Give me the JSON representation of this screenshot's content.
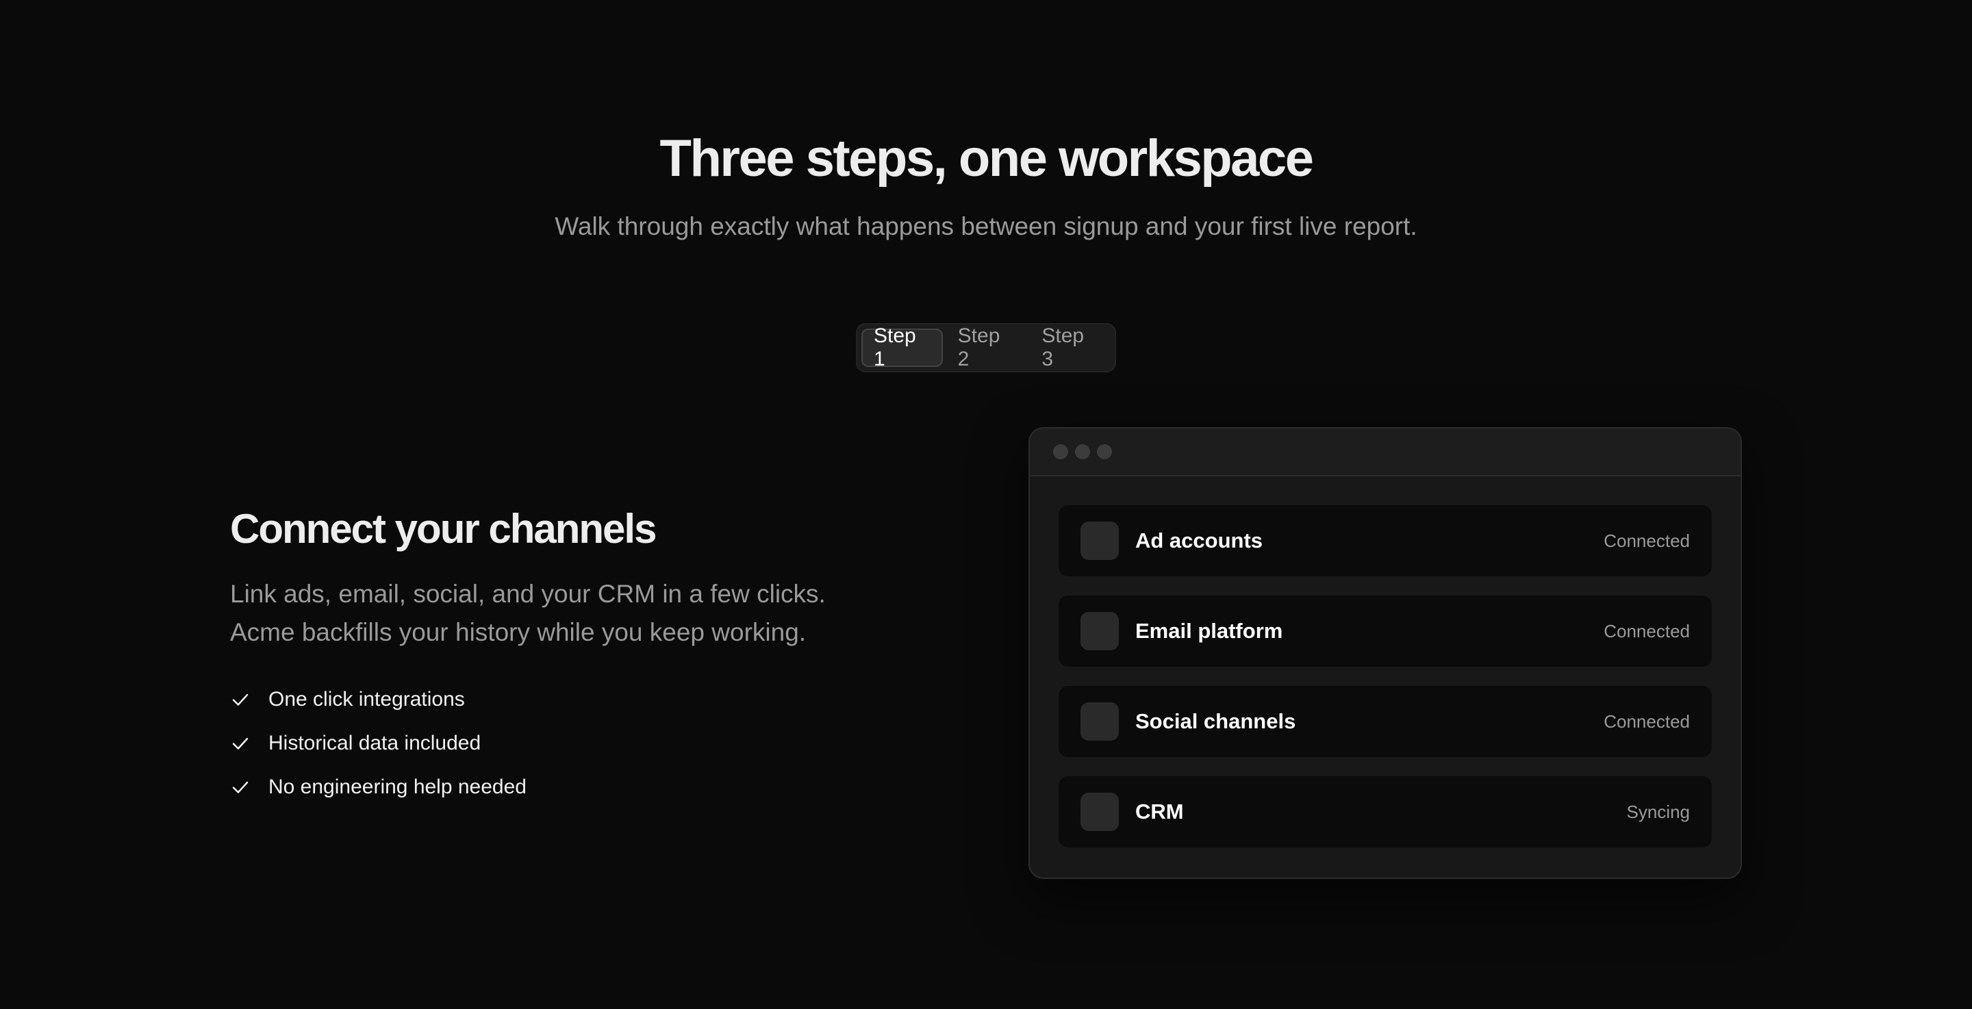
{
  "header": {
    "title": "Three steps, one workspace",
    "subtitle": "Walk through exactly what happens between signup and your first live report."
  },
  "tabs": [
    {
      "label": "Step 1",
      "active": true
    },
    {
      "label": "Step 2",
      "active": false
    },
    {
      "label": "Step 3",
      "active": false
    }
  ],
  "step": {
    "title": "Connect your channels",
    "description": "Link ads, email, social, and your CRM in a few clicks. Acme backfills your history while you keep working.",
    "features": [
      {
        "label": "One click integrations",
        "icon": "check-icon"
      },
      {
        "label": "Historical data included",
        "icon": "check-icon"
      },
      {
        "label": "No engineering help needed",
        "icon": "check-icon"
      }
    ]
  },
  "preview": {
    "integrations": [
      {
        "name": "Ad accounts",
        "status": "Connected"
      },
      {
        "name": "Email platform",
        "status": "Connected"
      },
      {
        "name": "Social channels",
        "status": "Connected"
      },
      {
        "name": "CRM",
        "status": "Syncing"
      }
    ]
  },
  "colors": {
    "background": "#0a0a0a",
    "text": "#ededed",
    "muted": "#9a9a9a",
    "panel": "#181818",
    "row": "#0b0b0b"
  }
}
